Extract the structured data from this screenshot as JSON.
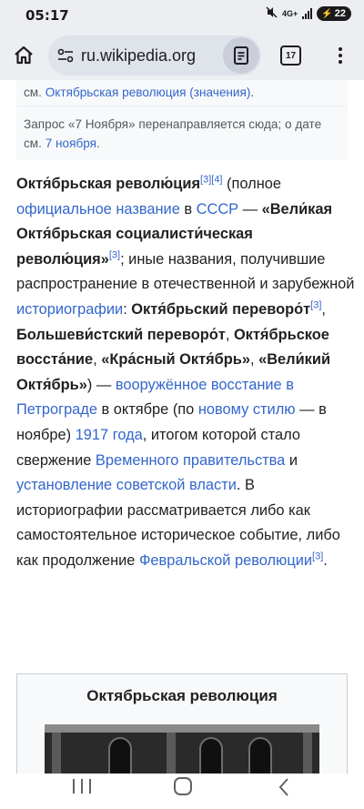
{
  "status_bar": {
    "time": "05:17",
    "network": "4G+",
    "battery": "22"
  },
  "browser": {
    "url": "ru.wikipedia.org",
    "tab_count": "17"
  },
  "hatnote": {
    "line1_prefix": "см. ",
    "line1_link": "Октябрьская революция (значения)",
    "line1_suffix": ".",
    "line2_text": "Запрос «7 Ноября» перенаправляется сюда; о дате см. ",
    "line2_link": "7 ноября",
    "line2_suffix": "."
  },
  "article": {
    "s1": "Октя́брьская револю́ция",
    "ref34": "[3][4]",
    "s2": " (полное ",
    "link_official": "официальное название",
    "s3": " в ",
    "link_ussr": "СССР",
    "s4": " — ",
    "s5": "«Вели́кая Октя́брьская социалисти́ческая револю́ция»",
    "ref3a": "[3]",
    "s6": "; иные названия, получившие распространение в отечественной и зарубежной ",
    "link_historiography": "историографии",
    "s7": ": ",
    "s8": "Октя́брьский переворо́т",
    "ref3b": "[3]",
    "s9": ", ",
    "s10": "Большеви́стский переворо́т",
    "s11": ", ",
    "s12": "Октя́брьское восста́ние",
    "s13": ", ",
    "s14": "«Кра́сный Октя́брь»",
    "s15": ", ",
    "s16": "«Вели́кий Октя́брь»",
    "s17": ") — ",
    "link_uprising": "вооружённое восстание в Петрограде",
    "s18": " в октябре (по ",
    "link_newstyle": "новому стилю",
    "s19": " — в ноябре) ",
    "link_1917": "1917 года",
    "s20": ", итогом которой стало свержение ",
    "link_provisional": "Временного правительства",
    "s21": " и ",
    "link_soviet": "установление советской власти",
    "s22": ". В историографии рассматривается либо как самостоятельное историческое событие, либо как продолжение ",
    "link_february": "Февральской революции",
    "ref3c": "[3]",
    "s23": "."
  },
  "infobox": {
    "title": "Октябрьская революция"
  },
  "colors": {
    "link": "#3366cc",
    "chrome": "#eceef2",
    "text": "#202122"
  }
}
